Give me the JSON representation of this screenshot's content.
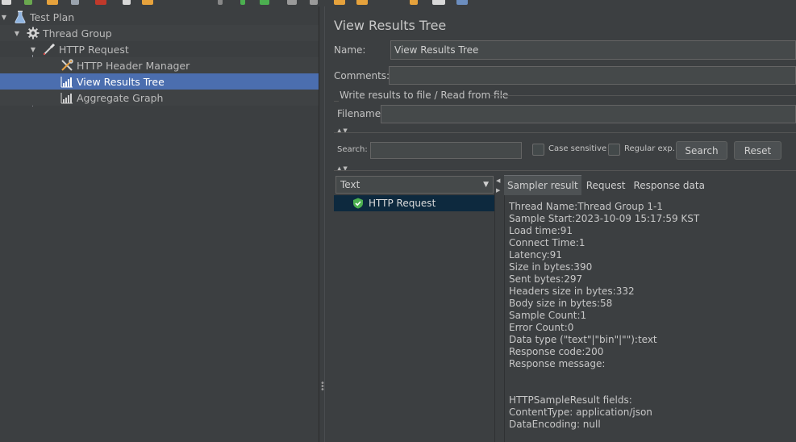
{
  "tree": {
    "items": [
      {
        "label": "Test Plan",
        "icon": "flask-icon"
      },
      {
        "label": "Thread Group",
        "icon": "gear-icon"
      },
      {
        "label": "HTTP Request",
        "icon": "pipette-icon"
      },
      {
        "label": "HTTP Header Manager",
        "icon": "wrench-icon"
      },
      {
        "label": "View Results Tree",
        "icon": "graph-icon"
      },
      {
        "label": "Aggregate Graph",
        "icon": "graph-icon"
      }
    ]
  },
  "panel": {
    "title": "View Results Tree",
    "name_label": "Name:",
    "name_value": "View Results Tree",
    "comments_label": "Comments:",
    "comments_value": "",
    "file_section": "Write results to file / Read from file",
    "filename_label": "Filename",
    "filename_value": ""
  },
  "search": {
    "label": "Search:",
    "value": "",
    "case_sensitive": "Case sensitive",
    "regular_exp": "Regular exp.",
    "search_button": "Search",
    "reset_button": "Reset"
  },
  "renderer": {
    "selected": "Text"
  },
  "results": {
    "items": [
      {
        "label": "HTTP Request",
        "status": "success"
      }
    ]
  },
  "tabs": [
    "Sampler result",
    "Request",
    "Response data"
  ],
  "sampler_result": {
    "lines": [
      "Thread Name:Thread Group 1-1",
      "Sample Start:2023-10-09 15:17:59 KST",
      "Load time:91",
      "Connect Time:1",
      "Latency:91",
      "Size in bytes:390",
      "Sent bytes:297",
      "Headers size in bytes:332",
      "Body size in bytes:58",
      "Sample Count:1",
      "Error Count:0",
      "Data type (\"text\"|\"bin\"|\"\"):text",
      "Response code:200",
      "Response message:",
      "",
      "",
      "HTTPSampleResult fields:",
      "ContentType: application/json",
      "DataEncoding: null"
    ]
  },
  "colors": {
    "background": "#3c3f41",
    "selection": "#4b6eaf",
    "success": "#4caf50"
  }
}
